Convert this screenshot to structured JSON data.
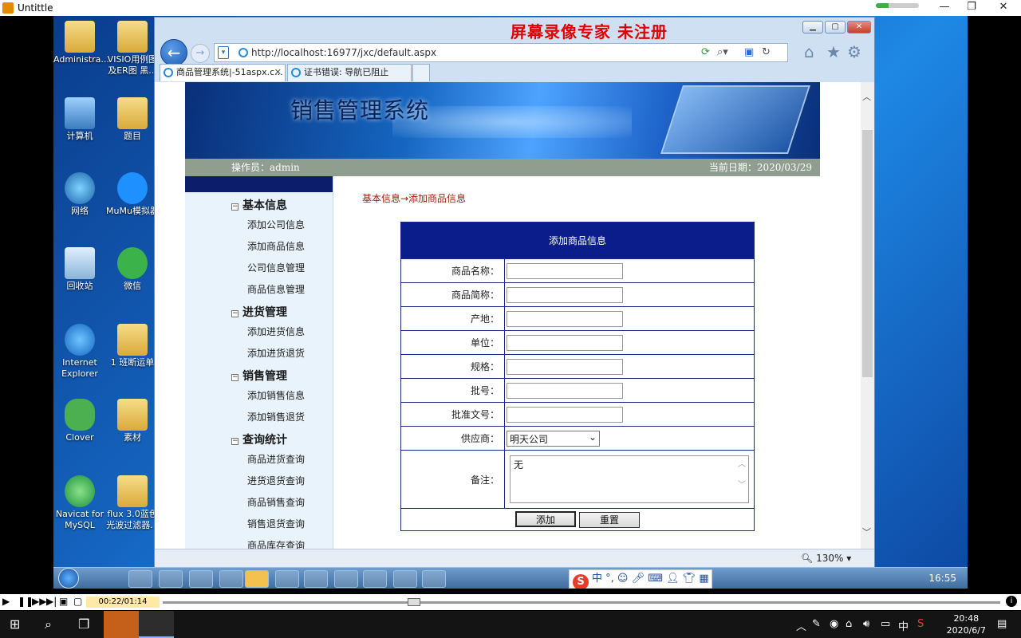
{
  "player": {
    "title": "Untittle",
    "minimize": "—",
    "restore": "❐",
    "close": "✕",
    "elapsed": "00:22/01:14"
  },
  "desktop": {
    "icons": [
      {
        "label": "Administra...",
        "kind": "folder"
      },
      {
        "label": "VISIO用例图及ER图 黑...",
        "kind": "folder"
      },
      {
        "label": "计算机",
        "kind": "computer"
      },
      {
        "label": "题目",
        "kind": "folder"
      },
      {
        "label": "网络",
        "kind": "network"
      },
      {
        "label": "MuMu模拟器",
        "kind": "mumu"
      },
      {
        "label": "回收站",
        "kind": "recycle"
      },
      {
        "label": "微信",
        "kind": "wechat"
      },
      {
        "label": "Internet Explorer",
        "kind": "ie"
      },
      {
        "label": "1  班断运单",
        "kind": "folder"
      },
      {
        "label": "Clover",
        "kind": "clover"
      },
      {
        "label": "素材",
        "kind": "folder"
      },
      {
        "label": "Navicat for MySQL",
        "kind": "navicat"
      },
      {
        "label": "flux 3.0蓝色光波过滤器...",
        "kind": "folder"
      }
    ]
  },
  "browser": {
    "watermark": "屏幕录像专家  未注册",
    "url": "http://localhost:16977/jxc/default.aspx",
    "tabs": [
      {
        "label": "商品管理系统|-51aspx.c...",
        "active": true
      },
      {
        "label": "证书错误: 导航已阻止",
        "active": false
      }
    ],
    "zoom": "130%"
  },
  "site": {
    "banner_title": "销售管理系统",
    "operator": "操作员：admin",
    "current_date": "当前日期：2020/03/29",
    "breadcrumb": "基本信息→添加商品信息",
    "menu": [
      {
        "group": "基本信息",
        "items": [
          "添加公司信息",
          "添加商品信息",
          "公司信息管理",
          "商品信息管理"
        ]
      },
      {
        "group": "进货管理",
        "items": [
          "添加进货信息",
          "添加进货退货"
        ]
      },
      {
        "group": "销售管理",
        "items": [
          "添加销售信息",
          "添加销售退货"
        ]
      },
      {
        "group": "查询统计",
        "items": [
          "商品进货查询",
          "进货退货查询",
          "商品销售查询",
          "销售退货查询",
          "商品库存查询"
        ]
      }
    ],
    "form": {
      "header": "添加商品信息",
      "fields": [
        {
          "label": "商品名称：",
          "value": ""
        },
        {
          "label": "商品简称：",
          "value": ""
        },
        {
          "label": "产地：",
          "value": ""
        },
        {
          "label": "单位：",
          "value": ""
        },
        {
          "label": "规格：",
          "value": ""
        },
        {
          "label": "批号：",
          "value": ""
        },
        {
          "label": "批准文号：",
          "value": ""
        }
      ],
      "supplier_label": "供应商：",
      "supplier_value": "明天公司",
      "memo_label": "备注：",
      "memo_value": "无",
      "add_button": "添加",
      "reset_button": "重置"
    }
  },
  "rec_taskbar": {
    "ime": "中 °,",
    "clock": "16:55"
  },
  "host_taskbar": {
    "time": "20:48",
    "date": "2020/6/7",
    "ime": "中"
  }
}
